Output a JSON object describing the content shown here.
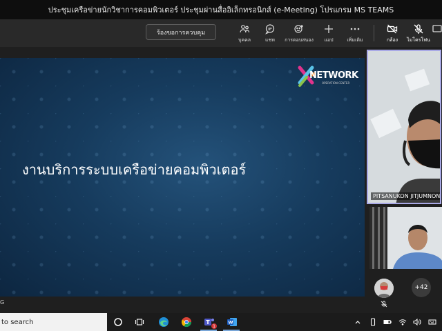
{
  "window": {
    "title": "ประชุมเครือข่ายนักวิชาการคอมพิวเตอร์ ประชุมผ่านสื่ออิเล็กทรอนิกส์ (e-Meeting) โปรแกรม MS TEAMS"
  },
  "toolbar": {
    "request_control_label": "ร้องขอการควบคุม",
    "buttons": [
      {
        "label": "บุคคล"
      },
      {
        "label": "แชท"
      },
      {
        "label": "การตอบสนอง"
      },
      {
        "label": "แอป"
      },
      {
        "label": "เพิ่มเติม"
      },
      {
        "label": "กล้อง"
      },
      {
        "label": "ไมโครโฟน"
      }
    ]
  },
  "slide": {
    "title": "งานบริการระบบเครือข่ายคอมพิวเตอร์",
    "logo_text": "NETWORK",
    "logo_subtitle": "OPERATION CENTER",
    "corner_text": "G"
  },
  "participants": {
    "main_name": "PITSANUKON JITJUMNONG",
    "more_count": "+42"
  },
  "taskbar": {
    "search_placeholder": "to search",
    "teams_badge": "1"
  },
  "colors": {
    "accent_border": "#a9a9e6",
    "slide_blue": "#163b5d"
  }
}
